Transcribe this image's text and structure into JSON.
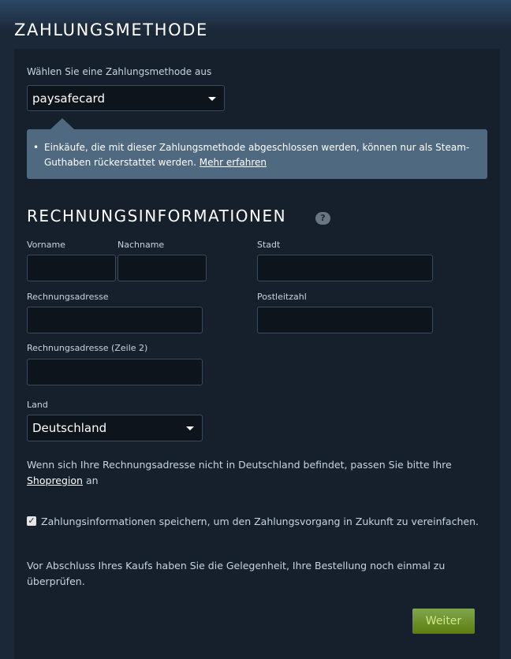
{
  "header": {
    "title": "ZAHLUNGSMETHODE"
  },
  "payment": {
    "label": "Wählen Sie eine Zahlungsmethode aus",
    "selected": "paysafecard",
    "notice_text": "Einkäufe, die mit dieser Zahlungsmethode abgeschlossen werden, können nur als Steam-Guthaben rückerstattet werden.",
    "notice_link": "Mehr erfahren"
  },
  "billing": {
    "title": "RECHNUNGSINFORMATIONEN",
    "help": "?",
    "first_name_label": "Vorname",
    "last_name_label": "Nachname",
    "city_label": "Stadt",
    "address_label": "Rechnungsadresse",
    "postal_label": "Postleitzahl",
    "address2_label": "Rechnungsadresse (Zeile 2)",
    "country_label": "Land",
    "country_selected": "Deutschland",
    "region_note": "Wenn sich Ihre Rechnungsadresse nicht in Deutschland befindet, passen Sie bitte Ihre",
    "region_link": "Shopregion",
    "region_suffix": "an",
    "save_checkbox_label": "Zahlungsinformationen speichern, um den Zahlungsvorgang in Zukunft zu vereinfachen.",
    "review_note": "Vor Abschluss Ihres Kaufs haben Sie die Gelegenheit, Ihre Bestellung noch einmal zu überprüfen.",
    "continue_button": "Weiter"
  },
  "colors": {
    "background": "#1b2838",
    "panel": "#16202d",
    "notice": "#4f6a80",
    "button": "#6b8f1f"
  }
}
